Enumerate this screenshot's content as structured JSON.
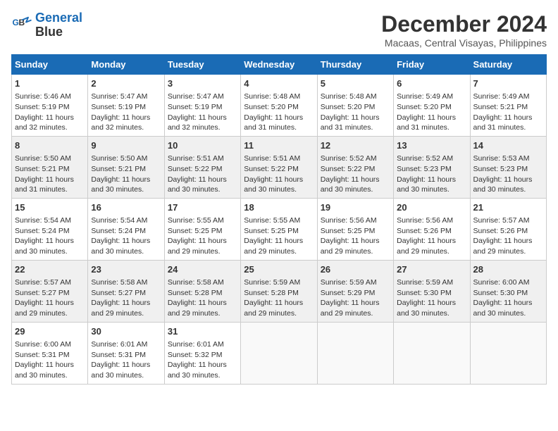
{
  "header": {
    "logo_line1": "General",
    "logo_line2": "Blue",
    "title": "December 2024",
    "subtitle": "Macaas, Central Visayas, Philippines"
  },
  "calendar": {
    "headers": [
      "Sunday",
      "Monday",
      "Tuesday",
      "Wednesday",
      "Thursday",
      "Friday",
      "Saturday"
    ],
    "weeks": [
      [
        {
          "day": "1",
          "info": "Sunrise: 5:46 AM\nSunset: 5:19 PM\nDaylight: 11 hours\nand 32 minutes."
        },
        {
          "day": "2",
          "info": "Sunrise: 5:47 AM\nSunset: 5:19 PM\nDaylight: 11 hours\nand 32 minutes."
        },
        {
          "day": "3",
          "info": "Sunrise: 5:47 AM\nSunset: 5:19 PM\nDaylight: 11 hours\nand 32 minutes."
        },
        {
          "day": "4",
          "info": "Sunrise: 5:48 AM\nSunset: 5:20 PM\nDaylight: 11 hours\nand 31 minutes."
        },
        {
          "day": "5",
          "info": "Sunrise: 5:48 AM\nSunset: 5:20 PM\nDaylight: 11 hours\nand 31 minutes."
        },
        {
          "day": "6",
          "info": "Sunrise: 5:49 AM\nSunset: 5:20 PM\nDaylight: 11 hours\nand 31 minutes."
        },
        {
          "day": "7",
          "info": "Sunrise: 5:49 AM\nSunset: 5:21 PM\nDaylight: 11 hours\nand 31 minutes."
        }
      ],
      [
        {
          "day": "8",
          "info": "Sunrise: 5:50 AM\nSunset: 5:21 PM\nDaylight: 11 hours\nand 31 minutes."
        },
        {
          "day": "9",
          "info": "Sunrise: 5:50 AM\nSunset: 5:21 PM\nDaylight: 11 hours\nand 30 minutes."
        },
        {
          "day": "10",
          "info": "Sunrise: 5:51 AM\nSunset: 5:22 PM\nDaylight: 11 hours\nand 30 minutes."
        },
        {
          "day": "11",
          "info": "Sunrise: 5:51 AM\nSunset: 5:22 PM\nDaylight: 11 hours\nand 30 minutes."
        },
        {
          "day": "12",
          "info": "Sunrise: 5:52 AM\nSunset: 5:22 PM\nDaylight: 11 hours\nand 30 minutes."
        },
        {
          "day": "13",
          "info": "Sunrise: 5:52 AM\nSunset: 5:23 PM\nDaylight: 11 hours\nand 30 minutes."
        },
        {
          "day": "14",
          "info": "Sunrise: 5:53 AM\nSunset: 5:23 PM\nDaylight: 11 hours\nand 30 minutes."
        }
      ],
      [
        {
          "day": "15",
          "info": "Sunrise: 5:54 AM\nSunset: 5:24 PM\nDaylight: 11 hours\nand 30 minutes."
        },
        {
          "day": "16",
          "info": "Sunrise: 5:54 AM\nSunset: 5:24 PM\nDaylight: 11 hours\nand 30 minutes."
        },
        {
          "day": "17",
          "info": "Sunrise: 5:55 AM\nSunset: 5:25 PM\nDaylight: 11 hours\nand 29 minutes."
        },
        {
          "day": "18",
          "info": "Sunrise: 5:55 AM\nSunset: 5:25 PM\nDaylight: 11 hours\nand 29 minutes."
        },
        {
          "day": "19",
          "info": "Sunrise: 5:56 AM\nSunset: 5:25 PM\nDaylight: 11 hours\nand 29 minutes."
        },
        {
          "day": "20",
          "info": "Sunrise: 5:56 AM\nSunset: 5:26 PM\nDaylight: 11 hours\nand 29 minutes."
        },
        {
          "day": "21",
          "info": "Sunrise: 5:57 AM\nSunset: 5:26 PM\nDaylight: 11 hours\nand 29 minutes."
        }
      ],
      [
        {
          "day": "22",
          "info": "Sunrise: 5:57 AM\nSunset: 5:27 PM\nDaylight: 11 hours\nand 29 minutes."
        },
        {
          "day": "23",
          "info": "Sunrise: 5:58 AM\nSunset: 5:27 PM\nDaylight: 11 hours\nand 29 minutes."
        },
        {
          "day": "24",
          "info": "Sunrise: 5:58 AM\nSunset: 5:28 PM\nDaylight: 11 hours\nand 29 minutes."
        },
        {
          "day": "25",
          "info": "Sunrise: 5:59 AM\nSunset: 5:28 PM\nDaylight: 11 hours\nand 29 minutes."
        },
        {
          "day": "26",
          "info": "Sunrise: 5:59 AM\nSunset: 5:29 PM\nDaylight: 11 hours\nand 29 minutes."
        },
        {
          "day": "27",
          "info": "Sunrise: 5:59 AM\nSunset: 5:30 PM\nDaylight: 11 hours\nand 30 minutes."
        },
        {
          "day": "28",
          "info": "Sunrise: 6:00 AM\nSunset: 5:30 PM\nDaylight: 11 hours\nand 30 minutes."
        }
      ],
      [
        {
          "day": "29",
          "info": "Sunrise: 6:00 AM\nSunset: 5:31 PM\nDaylight: 11 hours\nand 30 minutes."
        },
        {
          "day": "30",
          "info": "Sunrise: 6:01 AM\nSunset: 5:31 PM\nDaylight: 11 hours\nand 30 minutes."
        },
        {
          "day": "31",
          "info": "Sunrise: 6:01 AM\nSunset: 5:32 PM\nDaylight: 11 hours\nand 30 minutes."
        },
        {
          "day": "",
          "info": ""
        },
        {
          "day": "",
          "info": ""
        },
        {
          "day": "",
          "info": ""
        },
        {
          "day": "",
          "info": ""
        }
      ]
    ]
  }
}
